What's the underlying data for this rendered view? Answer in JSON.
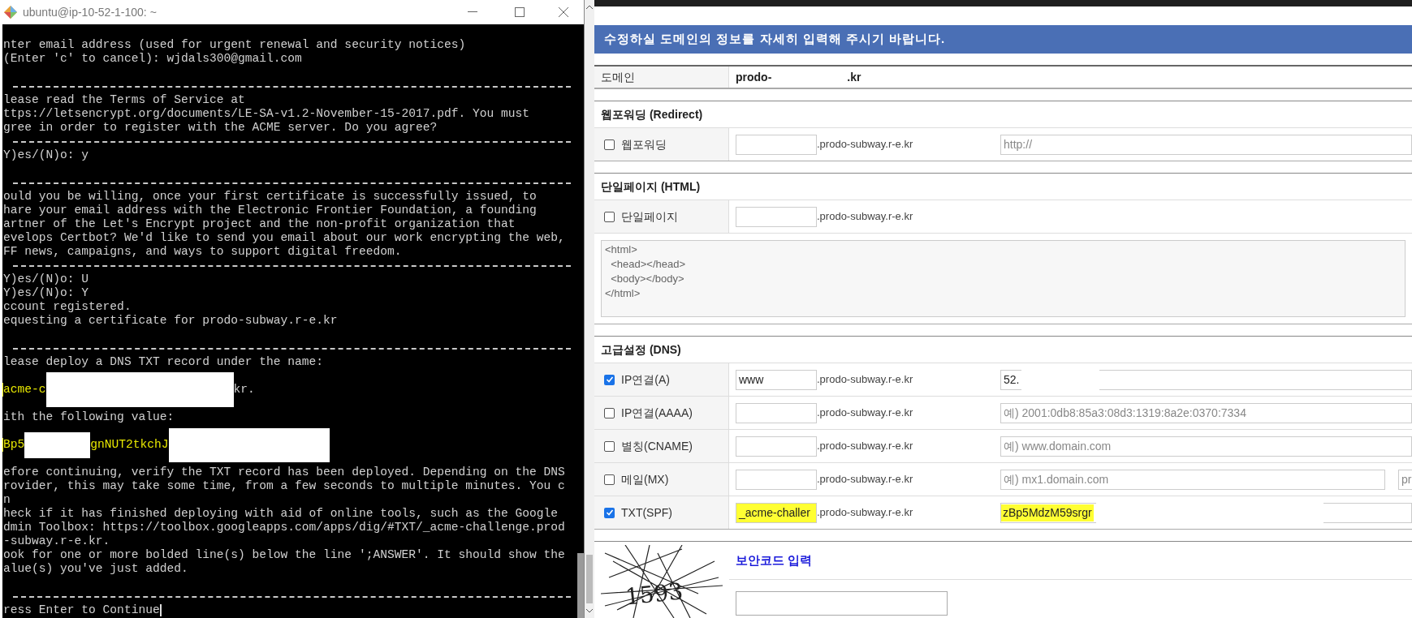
{
  "terminal": {
    "title": "ubuntu@ip-10-52-1-100: ~",
    "lines": [
      {
        "kind": "text",
        "text": "nter email address (used for urgent renewal and security notices)"
      },
      {
        "kind": "text",
        "text": "(Enter 'c' to cancel): wjdals300@gmail.com"
      },
      {
        "kind": "blank"
      },
      {
        "kind": "rule"
      },
      {
        "kind": "text",
        "text": "lease read the Terms of Service at"
      },
      {
        "kind": "text",
        "text": "ttps://letsencrypt.org/documents/LE-SA-v1.2-November-15-2017.pdf. You must"
      },
      {
        "kind": "text",
        "text": "gree in order to register with the ACME server. Do you agree?"
      },
      {
        "kind": "rule"
      },
      {
        "kind": "text",
        "text": "Y)es/(N)o: y"
      },
      {
        "kind": "blank"
      },
      {
        "kind": "rule"
      },
      {
        "kind": "text",
        "text": "ould you be willing, once your first certificate is successfully issued, to"
      },
      {
        "kind": "text",
        "text": "hare your email address with the Electronic Frontier Foundation, a founding"
      },
      {
        "kind": "text",
        "text": "artner of the Let's Encrypt project and the non-profit organization that"
      },
      {
        "kind": "text",
        "text": "evelops Certbot? We'd like to send you email about our work encrypting the web,"
      },
      {
        "kind": "text",
        "text": "FF news, campaigns, and ways to support digital freedom."
      },
      {
        "kind": "rule"
      },
      {
        "kind": "text",
        "text": "Y)es/(N)o: U"
      },
      {
        "kind": "text",
        "text": "Y)es/(N)o: Y"
      },
      {
        "kind": "text",
        "text": "ccount registered."
      },
      {
        "kind": "text",
        "text": "equesting a certificate for prodo-subway.r-e.kr"
      },
      {
        "kind": "blank"
      },
      {
        "kind": "rule"
      },
      {
        "kind": "text",
        "text": "lease deploy a DNS TXT record under the name:"
      },
      {
        "kind": "blank"
      },
      {
        "kind": "segments",
        "segments": [
          {
            "kind": "text",
            "text": "acme-c",
            "highlight": true
          },
          {
            "kind": "redacted"
          },
          {
            "kind": "text",
            "text": "kr.",
            "highlight": false
          }
        ]
      },
      {
        "kind": "blank"
      },
      {
        "kind": "text",
        "text": "ith the following value:"
      },
      {
        "kind": "blank"
      },
      {
        "kind": "segments",
        "segments": [
          {
            "kind": "text",
            "text": "Bp5",
            "highlight": true
          },
          {
            "kind": "redacted"
          },
          {
            "kind": "text",
            "text": "gnNUT2tkchJ",
            "highlight": true
          },
          {
            "kind": "redacted"
          }
        ]
      },
      {
        "kind": "blank"
      },
      {
        "kind": "text",
        "text": "efore continuing, verify the TXT record has been deployed. Depending on the DNS"
      },
      {
        "kind": "text",
        "text": "rovider, this may take some time, from a few seconds to multiple minutes. You c"
      },
      {
        "kind": "text",
        "text": "n"
      },
      {
        "kind": "text",
        "text": "heck if it has finished deploying with aid of online tools, such as the Google"
      },
      {
        "kind": "text",
        "text": "dmin Toolbox: https://toolbox.googleapps.com/apps/dig/#TXT/_acme-challenge.prod"
      },
      {
        "kind": "text",
        "text": "-subway.r-e.kr."
      },
      {
        "kind": "text",
        "text": "ook for one or more bolded line(s) below the line ';ANSWER'. It should show the"
      },
      {
        "kind": "text",
        "text": "alue(s) you've just added."
      },
      {
        "kind": "blank"
      },
      {
        "kind": "rule"
      },
      {
        "kind": "text",
        "text": "ress Enter to Continue",
        "cursor": true
      }
    ]
  },
  "browser": {
    "banner": "수정하실 도메인의 정보를 자세히 입력해 주시기 바랍니다.",
    "domain": {
      "label": "도메인",
      "value_start": "prodo-",
      "value_end": ".kr"
    },
    "sections": [
      {
        "title": "웹포워딩 (Redirect)",
        "rows": [
          {
            "label": "웹포워딩",
            "checked": false,
            "suffix": ".prodo-subway.r-e.kr",
            "value_placeholder": "http://"
          }
        ]
      },
      {
        "title": "단일페이지 (HTML)",
        "rows": [
          {
            "label": "단일페이지",
            "checked": false,
            "suffix": ".prodo-subway.r-e.kr"
          }
        ],
        "html": "<html>\n  <head></head>\n  <body></body>\n</html>"
      },
      {
        "title": "고급설정 (DNS)",
        "rows": [
          {
            "label": "IP연결(A)",
            "checked": true,
            "host": "www",
            "suffix": ".prodo-subway.r-e.kr",
            "value": "52.",
            "redacted": true
          },
          {
            "label": "IP연결(AAAA)",
            "checked": false,
            "suffix": ".prodo-subway.r-e.kr",
            "value_placeholder": "예) 2001:0db8:85a3:08d3:1319:8a2e:0370:7334"
          },
          {
            "label": "별칭(CNAME)",
            "checked": false,
            "suffix": ".prodo-subway.r-e.kr",
            "value_placeholder": "예) www.domain.com"
          },
          {
            "label": "메일(MX)",
            "checked": false,
            "suffix": ".prodo-subway.r-e.kr",
            "value_placeholder": "예) mx1.domain.com",
            "extra_placeholder": "pr"
          },
          {
            "label": "TXT(SPF)",
            "checked": true,
            "host": "_acme-challer",
            "suffix": ".prodo-subway.r-e.kr",
            "value": "zBp5MdzM59srgr",
            "redacted": true,
            "highlighted": true
          }
        ]
      }
    ],
    "captcha": {
      "code": "1593",
      "title": "보안코드 입력"
    }
  }
}
